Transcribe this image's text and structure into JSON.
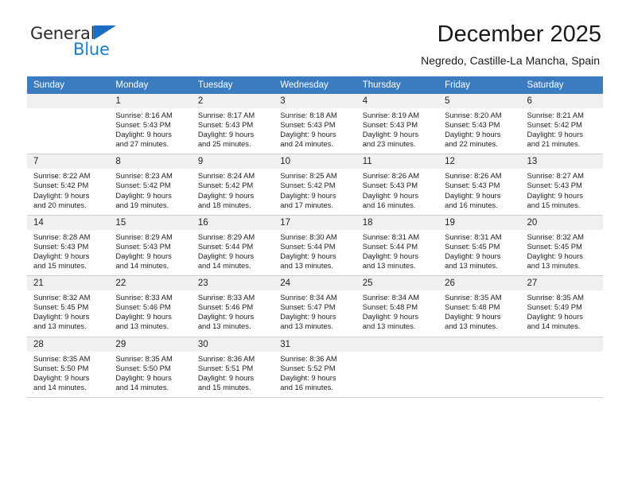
{
  "brand": {
    "name_top": "General",
    "name_bottom": "Blue",
    "accent_dark": "#2b2b2b",
    "accent_blue": "#1a7fd4",
    "triangle_color": "#1a6fc4"
  },
  "header": {
    "title": "December 2025",
    "subtitle": "Negredo, Castille-La Mancha, Spain",
    "header_bg": "#3b7cc0",
    "daynum_bg": "#f0f0f0"
  },
  "weekday_headers": [
    "Sunday",
    "Monday",
    "Tuesday",
    "Wednesday",
    "Thursday",
    "Friday",
    "Saturday"
  ],
  "labels": {
    "sunrise_prefix": "Sunrise:",
    "sunset_prefix": "Sunset:",
    "daylight_prefix": "Daylight:"
  },
  "weeks": [
    [
      {
        "day": "",
        "blank": true
      },
      {
        "day": "1",
        "sunrise": "Sunrise: 8:16 AM",
        "sunset": "Sunset: 5:43 PM",
        "daylight_line1": "Daylight: 9 hours",
        "daylight_line2": "and 27 minutes."
      },
      {
        "day": "2",
        "sunrise": "Sunrise: 8:17 AM",
        "sunset": "Sunset: 5:43 PM",
        "daylight_line1": "Daylight: 9 hours",
        "daylight_line2": "and 25 minutes."
      },
      {
        "day": "3",
        "sunrise": "Sunrise: 8:18 AM",
        "sunset": "Sunset: 5:43 PM",
        "daylight_line1": "Daylight: 9 hours",
        "daylight_line2": "and 24 minutes."
      },
      {
        "day": "4",
        "sunrise": "Sunrise: 8:19 AM",
        "sunset": "Sunset: 5:43 PM",
        "daylight_line1": "Daylight: 9 hours",
        "daylight_line2": "and 23 minutes."
      },
      {
        "day": "5",
        "sunrise": "Sunrise: 8:20 AM",
        "sunset": "Sunset: 5:43 PM",
        "daylight_line1": "Daylight: 9 hours",
        "daylight_line2": "and 22 minutes."
      },
      {
        "day": "6",
        "sunrise": "Sunrise: 8:21 AM",
        "sunset": "Sunset: 5:42 PM",
        "daylight_line1": "Daylight: 9 hours",
        "daylight_line2": "and 21 minutes."
      }
    ],
    [
      {
        "day": "7",
        "sunrise": "Sunrise: 8:22 AM",
        "sunset": "Sunset: 5:42 PM",
        "daylight_line1": "Daylight: 9 hours",
        "daylight_line2": "and 20 minutes."
      },
      {
        "day": "8",
        "sunrise": "Sunrise: 8:23 AM",
        "sunset": "Sunset: 5:42 PM",
        "daylight_line1": "Daylight: 9 hours",
        "daylight_line2": "and 19 minutes."
      },
      {
        "day": "9",
        "sunrise": "Sunrise: 8:24 AM",
        "sunset": "Sunset: 5:42 PM",
        "daylight_line1": "Daylight: 9 hours",
        "daylight_line2": "and 18 minutes."
      },
      {
        "day": "10",
        "sunrise": "Sunrise: 8:25 AM",
        "sunset": "Sunset: 5:42 PM",
        "daylight_line1": "Daylight: 9 hours",
        "daylight_line2": "and 17 minutes."
      },
      {
        "day": "11",
        "sunrise": "Sunrise: 8:26 AM",
        "sunset": "Sunset: 5:43 PM",
        "daylight_line1": "Daylight: 9 hours",
        "daylight_line2": "and 16 minutes."
      },
      {
        "day": "12",
        "sunrise": "Sunrise: 8:26 AM",
        "sunset": "Sunset: 5:43 PM",
        "daylight_line1": "Daylight: 9 hours",
        "daylight_line2": "and 16 minutes."
      },
      {
        "day": "13",
        "sunrise": "Sunrise: 8:27 AM",
        "sunset": "Sunset: 5:43 PM",
        "daylight_line1": "Daylight: 9 hours",
        "daylight_line2": "and 15 minutes."
      }
    ],
    [
      {
        "day": "14",
        "sunrise": "Sunrise: 8:28 AM",
        "sunset": "Sunset: 5:43 PM",
        "daylight_line1": "Daylight: 9 hours",
        "daylight_line2": "and 15 minutes."
      },
      {
        "day": "15",
        "sunrise": "Sunrise: 8:29 AM",
        "sunset": "Sunset: 5:43 PM",
        "daylight_line1": "Daylight: 9 hours",
        "daylight_line2": "and 14 minutes."
      },
      {
        "day": "16",
        "sunrise": "Sunrise: 8:29 AM",
        "sunset": "Sunset: 5:44 PM",
        "daylight_line1": "Daylight: 9 hours",
        "daylight_line2": "and 14 minutes."
      },
      {
        "day": "17",
        "sunrise": "Sunrise: 8:30 AM",
        "sunset": "Sunset: 5:44 PM",
        "daylight_line1": "Daylight: 9 hours",
        "daylight_line2": "and 13 minutes."
      },
      {
        "day": "18",
        "sunrise": "Sunrise: 8:31 AM",
        "sunset": "Sunset: 5:44 PM",
        "daylight_line1": "Daylight: 9 hours",
        "daylight_line2": "and 13 minutes."
      },
      {
        "day": "19",
        "sunrise": "Sunrise: 8:31 AM",
        "sunset": "Sunset: 5:45 PM",
        "daylight_line1": "Daylight: 9 hours",
        "daylight_line2": "and 13 minutes."
      },
      {
        "day": "20",
        "sunrise": "Sunrise: 8:32 AM",
        "sunset": "Sunset: 5:45 PM",
        "daylight_line1": "Daylight: 9 hours",
        "daylight_line2": "and 13 minutes."
      }
    ],
    [
      {
        "day": "21",
        "sunrise": "Sunrise: 8:32 AM",
        "sunset": "Sunset: 5:45 PM",
        "daylight_line1": "Daylight: 9 hours",
        "daylight_line2": "and 13 minutes."
      },
      {
        "day": "22",
        "sunrise": "Sunrise: 8:33 AM",
        "sunset": "Sunset: 5:46 PM",
        "daylight_line1": "Daylight: 9 hours",
        "daylight_line2": "and 13 minutes."
      },
      {
        "day": "23",
        "sunrise": "Sunrise: 8:33 AM",
        "sunset": "Sunset: 5:46 PM",
        "daylight_line1": "Daylight: 9 hours",
        "daylight_line2": "and 13 minutes."
      },
      {
        "day": "24",
        "sunrise": "Sunrise: 8:34 AM",
        "sunset": "Sunset: 5:47 PM",
        "daylight_line1": "Daylight: 9 hours",
        "daylight_line2": "and 13 minutes."
      },
      {
        "day": "25",
        "sunrise": "Sunrise: 8:34 AM",
        "sunset": "Sunset: 5:48 PM",
        "daylight_line1": "Daylight: 9 hours",
        "daylight_line2": "and 13 minutes."
      },
      {
        "day": "26",
        "sunrise": "Sunrise: 8:35 AM",
        "sunset": "Sunset: 5:48 PM",
        "daylight_line1": "Daylight: 9 hours",
        "daylight_line2": "and 13 minutes."
      },
      {
        "day": "27",
        "sunrise": "Sunrise: 8:35 AM",
        "sunset": "Sunset: 5:49 PM",
        "daylight_line1": "Daylight: 9 hours",
        "daylight_line2": "and 14 minutes."
      }
    ],
    [
      {
        "day": "28",
        "sunrise": "Sunrise: 8:35 AM",
        "sunset": "Sunset: 5:50 PM",
        "daylight_line1": "Daylight: 9 hours",
        "daylight_line2": "and 14 minutes."
      },
      {
        "day": "29",
        "sunrise": "Sunrise: 8:35 AM",
        "sunset": "Sunset: 5:50 PM",
        "daylight_line1": "Daylight: 9 hours",
        "daylight_line2": "and 14 minutes."
      },
      {
        "day": "30",
        "sunrise": "Sunrise: 8:36 AM",
        "sunset": "Sunset: 5:51 PM",
        "daylight_line1": "Daylight: 9 hours",
        "daylight_line2": "and 15 minutes."
      },
      {
        "day": "31",
        "sunrise": "Sunrise: 8:36 AM",
        "sunset": "Sunset: 5:52 PM",
        "daylight_line1": "Daylight: 9 hours",
        "daylight_line2": "and 16 minutes."
      },
      {
        "day": "",
        "blank": true
      },
      {
        "day": "",
        "blank": true
      },
      {
        "day": "",
        "blank": true
      }
    ]
  ]
}
